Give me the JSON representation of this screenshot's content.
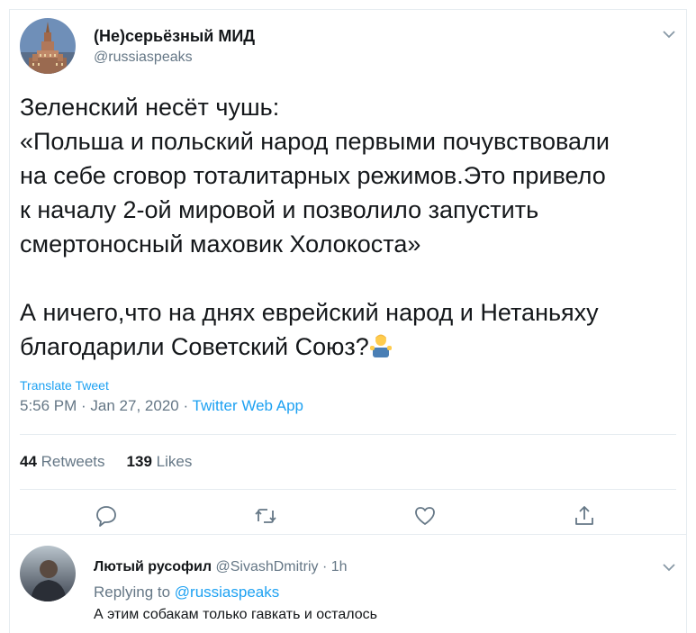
{
  "tweet": {
    "author_name": "(Не)серьёзный МИД",
    "author_handle": "@russiaspeaks",
    "text_lines": [
      "Зеленский несёт чушь:",
      "«Польша и польский народ первыми почувствовали",
      "на себе сговор тоталитарных режимов.Это привело",
      "к началу 2-ой мировой и позволило запустить",
      "смертоносный маховик Холокоста»",
      "",
      "А ничего,что на днях еврейский народ и Нетаньяху",
      "благодарили Советский Союз?"
    ],
    "emoji_icon": "man-shrugging-emoji",
    "translate_label": "Translate Tweet",
    "time": "5:56 PM",
    "date": "Jan 27, 2020",
    "separator": " · ",
    "app": "Twitter Web App",
    "retweets_count": "44",
    "retweets_label": "Retweets",
    "likes_count": "139",
    "likes_label": "Likes"
  },
  "icons": {
    "reply": "reply-icon",
    "retweet": "retweet-icon",
    "like": "heart-icon",
    "share": "share-icon",
    "menu": "chevron-down-icon"
  },
  "reply": {
    "author_name": "Лютый русофил",
    "author_handle": "@SivashDmitriy",
    "time_sep": " · ",
    "time": "1h",
    "replying_prefix": "Replying to ",
    "replying_mention": "@russiaspeaks",
    "text": "А этим собакам только гавкать и осталось"
  },
  "colors": {
    "accent": "#1da1f2",
    "secondary_text": "#657786",
    "divider": "#e6ecf0"
  }
}
